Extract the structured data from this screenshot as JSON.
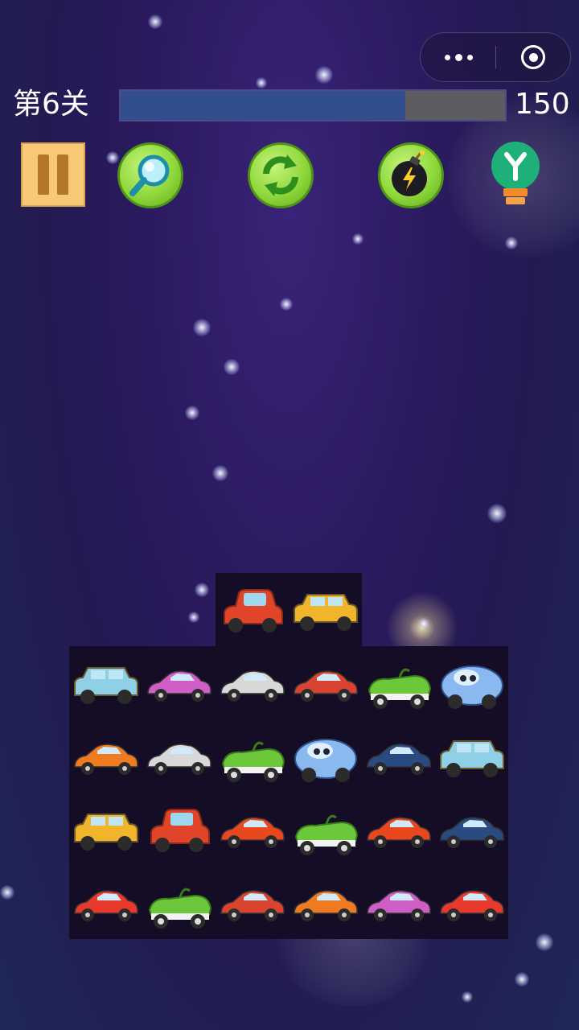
{
  "capsule": {
    "more_icon": "more-dots-icon",
    "close_icon": "target-close-icon"
  },
  "level": {
    "label": "第6关",
    "timer": "150",
    "progress": 0.74,
    "fill_color": "#324e8f",
    "track_color": "#5d5d61"
  },
  "tools": [
    {
      "name": "pause",
      "icon": "pause-icon"
    },
    {
      "name": "search",
      "icon": "magnifier-icon"
    },
    {
      "name": "shuffle",
      "icon": "refresh-icon"
    },
    {
      "name": "bomb",
      "icon": "bomb-icon"
    },
    {
      "name": "hint",
      "icon": "lightbulb-icon"
    }
  ],
  "board": {
    "top_row": [
      "red-beetle-car",
      "yellow-wagon"
    ],
    "rows": [
      [
        "blue-jeep",
        "purple-convertible",
        "silver-sedan",
        "red-sports-car",
        "green-buggy",
        "blue-bubble-car"
      ],
      [
        "orange-sedan",
        "silver-sedan",
        "green-buggy",
        "blue-bubble-car",
        "navy-coupe",
        "blue-jeep"
      ],
      [
        "yellow-wagon",
        "red-beetle-car",
        "red-roadster",
        "green-buggy",
        "red-roadster",
        "navy-coupe"
      ],
      [
        "red-classic-car",
        "green-buggy",
        "red-sports-car",
        "orange-sedan",
        "purple-convertible",
        "red-classic-car"
      ]
    ]
  },
  "car_colors": {
    "red-beetle-car": "#e0452a",
    "yellow-wagon": "#f0b52b",
    "blue-jeep": "#8fd0e6",
    "purple-convertible": "#cf5fc6",
    "silver-sedan": "#d8d8d8",
    "red-sports-car": "#d9432f",
    "green-buggy": "#6cc83a",
    "blue-bubble-car": "#8ab8f0",
    "orange-sedan": "#f07a20",
    "navy-coupe": "#2a4a82",
    "red-roadster": "#e9481f",
    "red-classic-car": "#e8392c"
  }
}
